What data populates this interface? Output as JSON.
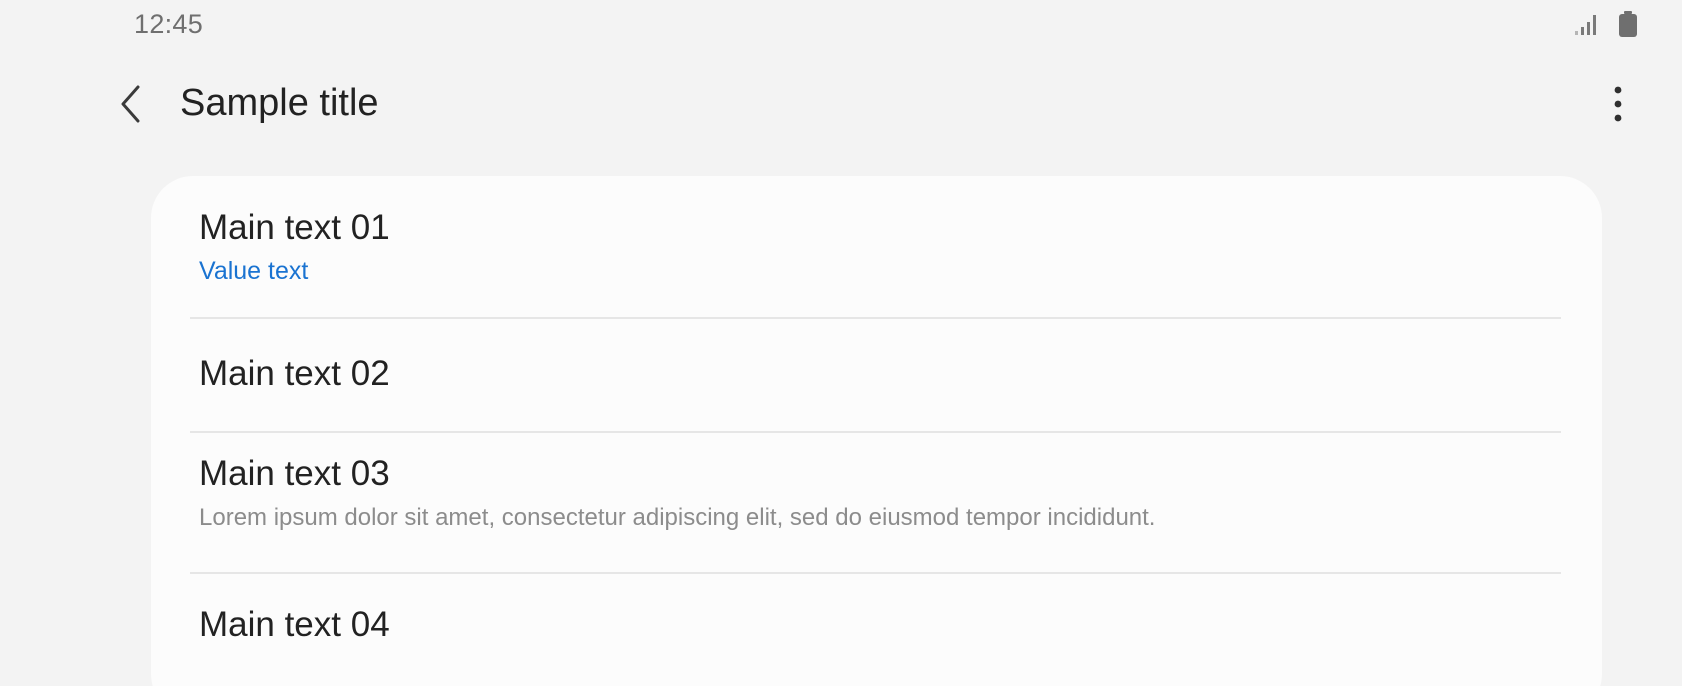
{
  "status_bar": {
    "time": "12:45",
    "signal_icon": "signal-icon",
    "battery_icon": "battery-icon"
  },
  "app_bar": {
    "back_icon": "back-arrow-icon",
    "title": "Sample title",
    "more_icon": "more-vert-icon"
  },
  "list": {
    "items": [
      {
        "main": "Main text 01",
        "value": "Value text"
      },
      {
        "main": "Main text 02"
      },
      {
        "main": "Main text 03",
        "sub": "Lorem ipsum dolor sit amet, consectetur adipiscing elit, sed do eiusmod tempor incididunt."
      },
      {
        "main": "Main text 04"
      }
    ]
  },
  "colors": {
    "background": "#f3f3f3",
    "card": "#fcfcfc",
    "accent": "#1a73d1",
    "primary_text": "#222222",
    "secondary_text": "#8c8c8c",
    "divider": "#e6e6e6"
  }
}
